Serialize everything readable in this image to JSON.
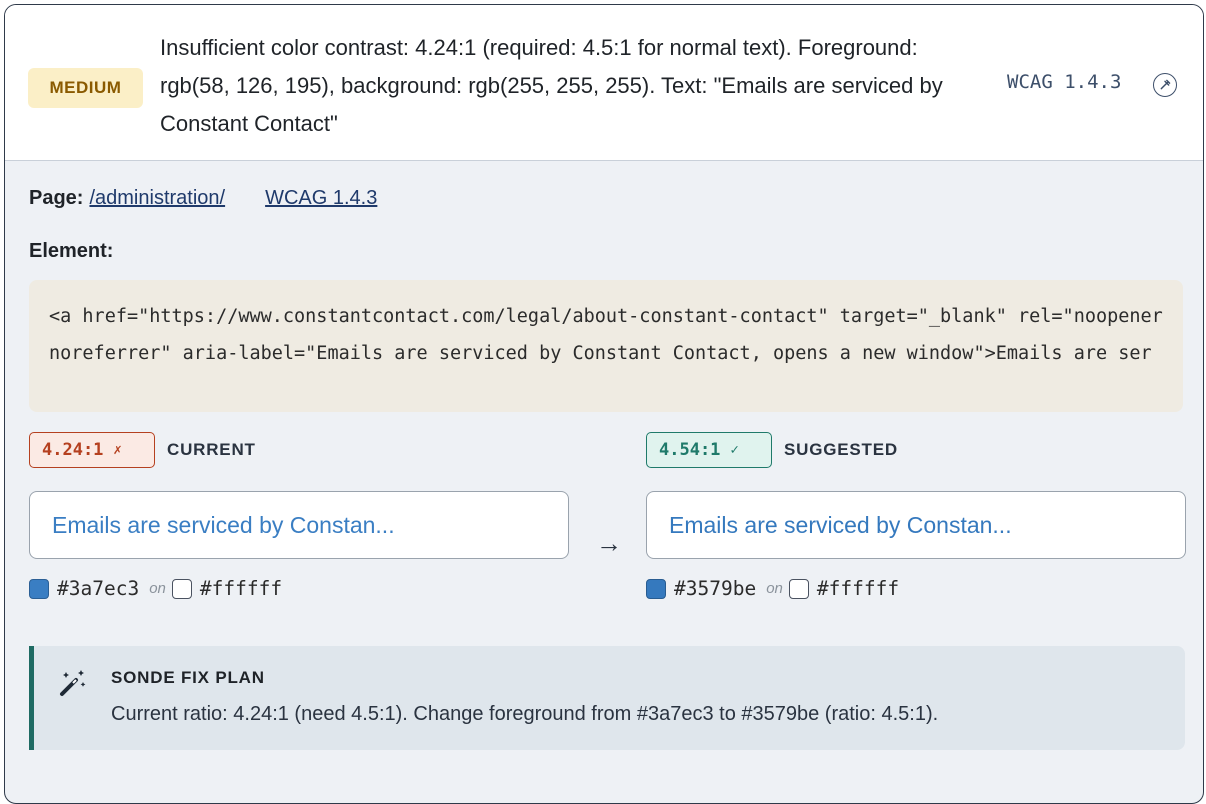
{
  "issue": {
    "severity": "MEDIUM",
    "summary": "Insufficient color contrast: 4.24:1 (required: 4.5:1 for normal text). Foreground: rgb(58, 126, 195), background: rgb(255, 255, 255). Text: \"Emails are serviced by Constant Contact\"",
    "wcag_ref": "WCAG 1.4.3"
  },
  "details": {
    "page_label": "Page:",
    "page_link": "/administration/",
    "wcag_link": "WCAG 1.4.3",
    "element_label": "Element:",
    "element_code": "<a href=\"https://www.constantcontact.com/legal/about-constant-contact\" target=\"_blank\" rel=\"noopener noreferrer\" aria-label=\"Emails are serviced by Constant Contact, opens a new window\">Emails are ser"
  },
  "current": {
    "ratio": "4.24:1",
    "mark": "✗",
    "label": "CURRENT",
    "preview_text": "Emails are serviced by Constan...",
    "fg_hex": "#3a7ec3",
    "on_text": "on",
    "bg_hex": "#ffffff"
  },
  "suggested": {
    "ratio": "4.54:1",
    "mark": "✓",
    "label": "SUGGESTED",
    "preview_text": "Emails are serviced by Constan...",
    "fg_hex": "#3579be",
    "on_text": "on",
    "bg_hex": "#ffffff"
  },
  "arrow": "→",
  "fix_plan": {
    "title": "SONDE FIX PLAN",
    "text": "Current ratio: 4.24:1 (need 4.5:1). Change foreground from #3a7ec3 to #3579be (ratio: 4.5:1).",
    "icon": "magic-wand-icon"
  },
  "colors": {
    "current_fg": "#3a7ec3",
    "suggested_fg": "#3579be",
    "background": "#ffffff"
  }
}
